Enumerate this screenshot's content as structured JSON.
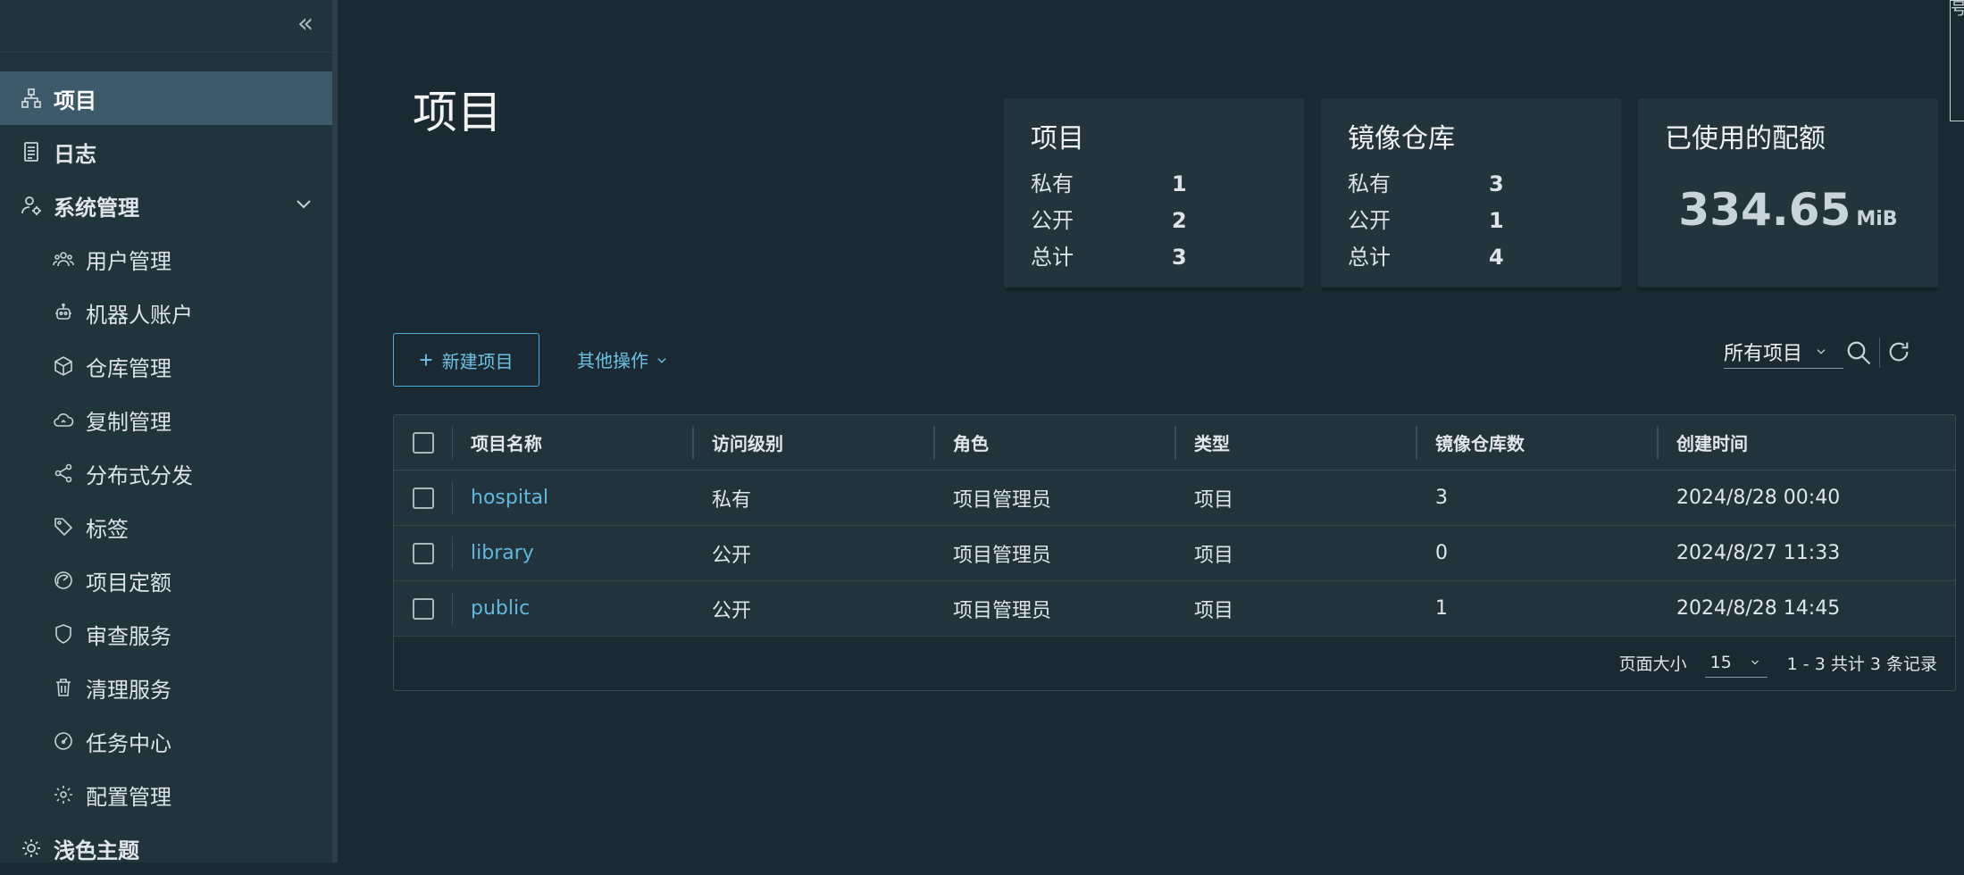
{
  "sidebar": {
    "collapse_label": "«",
    "items": [
      {
        "label": "项目",
        "icon": "project-icon",
        "active": true
      },
      {
        "label": "日志",
        "icon": "log-icon"
      },
      {
        "label": "系统管理",
        "icon": "admin-icon",
        "expandable": true
      },
      {
        "label": "用户管理",
        "icon": "users-icon"
      },
      {
        "label": "机器人账户",
        "icon": "robot-icon"
      },
      {
        "label": "仓库管理",
        "icon": "registry-icon"
      },
      {
        "label": "复制管理",
        "icon": "cloud-icon"
      },
      {
        "label": "分布式分发",
        "icon": "share-icon"
      },
      {
        "label": "标签",
        "icon": "tag-icon"
      },
      {
        "label": "项目定额",
        "icon": "dashboard-icon"
      },
      {
        "label": "审查服务",
        "icon": "shield-icon"
      },
      {
        "label": "清理服务",
        "icon": "trash-icon"
      },
      {
        "label": "任务中心",
        "icon": "speedometer-icon"
      },
      {
        "label": "配置管理",
        "icon": "gear-icon"
      },
      {
        "label": "浅色主题",
        "icon": "sun-icon"
      }
    ]
  },
  "page": {
    "title": "项目"
  },
  "cards": {
    "projects": {
      "title": "项目",
      "rows": [
        {
          "label": "私有",
          "value": "1"
        },
        {
          "label": "公开",
          "value": "2"
        },
        {
          "label": "总计",
          "value": "3"
        }
      ]
    },
    "repositories": {
      "title": "镜像仓库",
      "rows": [
        {
          "label": "私有",
          "value": "3"
        },
        {
          "label": "公开",
          "value": "1"
        },
        {
          "label": "总计",
          "value": "4"
        }
      ]
    },
    "quota": {
      "title": "已使用的配额",
      "value": "334.65",
      "unit": "MiB"
    }
  },
  "toolbar": {
    "new_project_label": "新建项目",
    "other_actions_label": "其他操作",
    "filter_value": "所有项目"
  },
  "table": {
    "columns": [
      "项目名称",
      "访问级别",
      "角色",
      "类型",
      "镜像仓库数",
      "创建时间"
    ],
    "rows": [
      {
        "name": "hospital",
        "access": "私有",
        "role": "项目管理员",
        "type": "项目",
        "repo_count": "3",
        "created": "2024/8/28 00:40"
      },
      {
        "name": "library",
        "access": "公开",
        "role": "项目管理员",
        "type": "项目",
        "repo_count": "0",
        "created": "2024/8/27 11:33"
      },
      {
        "name": "public",
        "access": "公开",
        "role": "项目管理员",
        "type": "项目",
        "repo_count": "1",
        "created": "2024/8/28 14:45"
      }
    ],
    "footer": {
      "page_size_label": "页面大小",
      "page_size_value": "15",
      "summary": "1 - 3 共计 3 条记录"
    }
  },
  "edge_tab_label": "号"
}
